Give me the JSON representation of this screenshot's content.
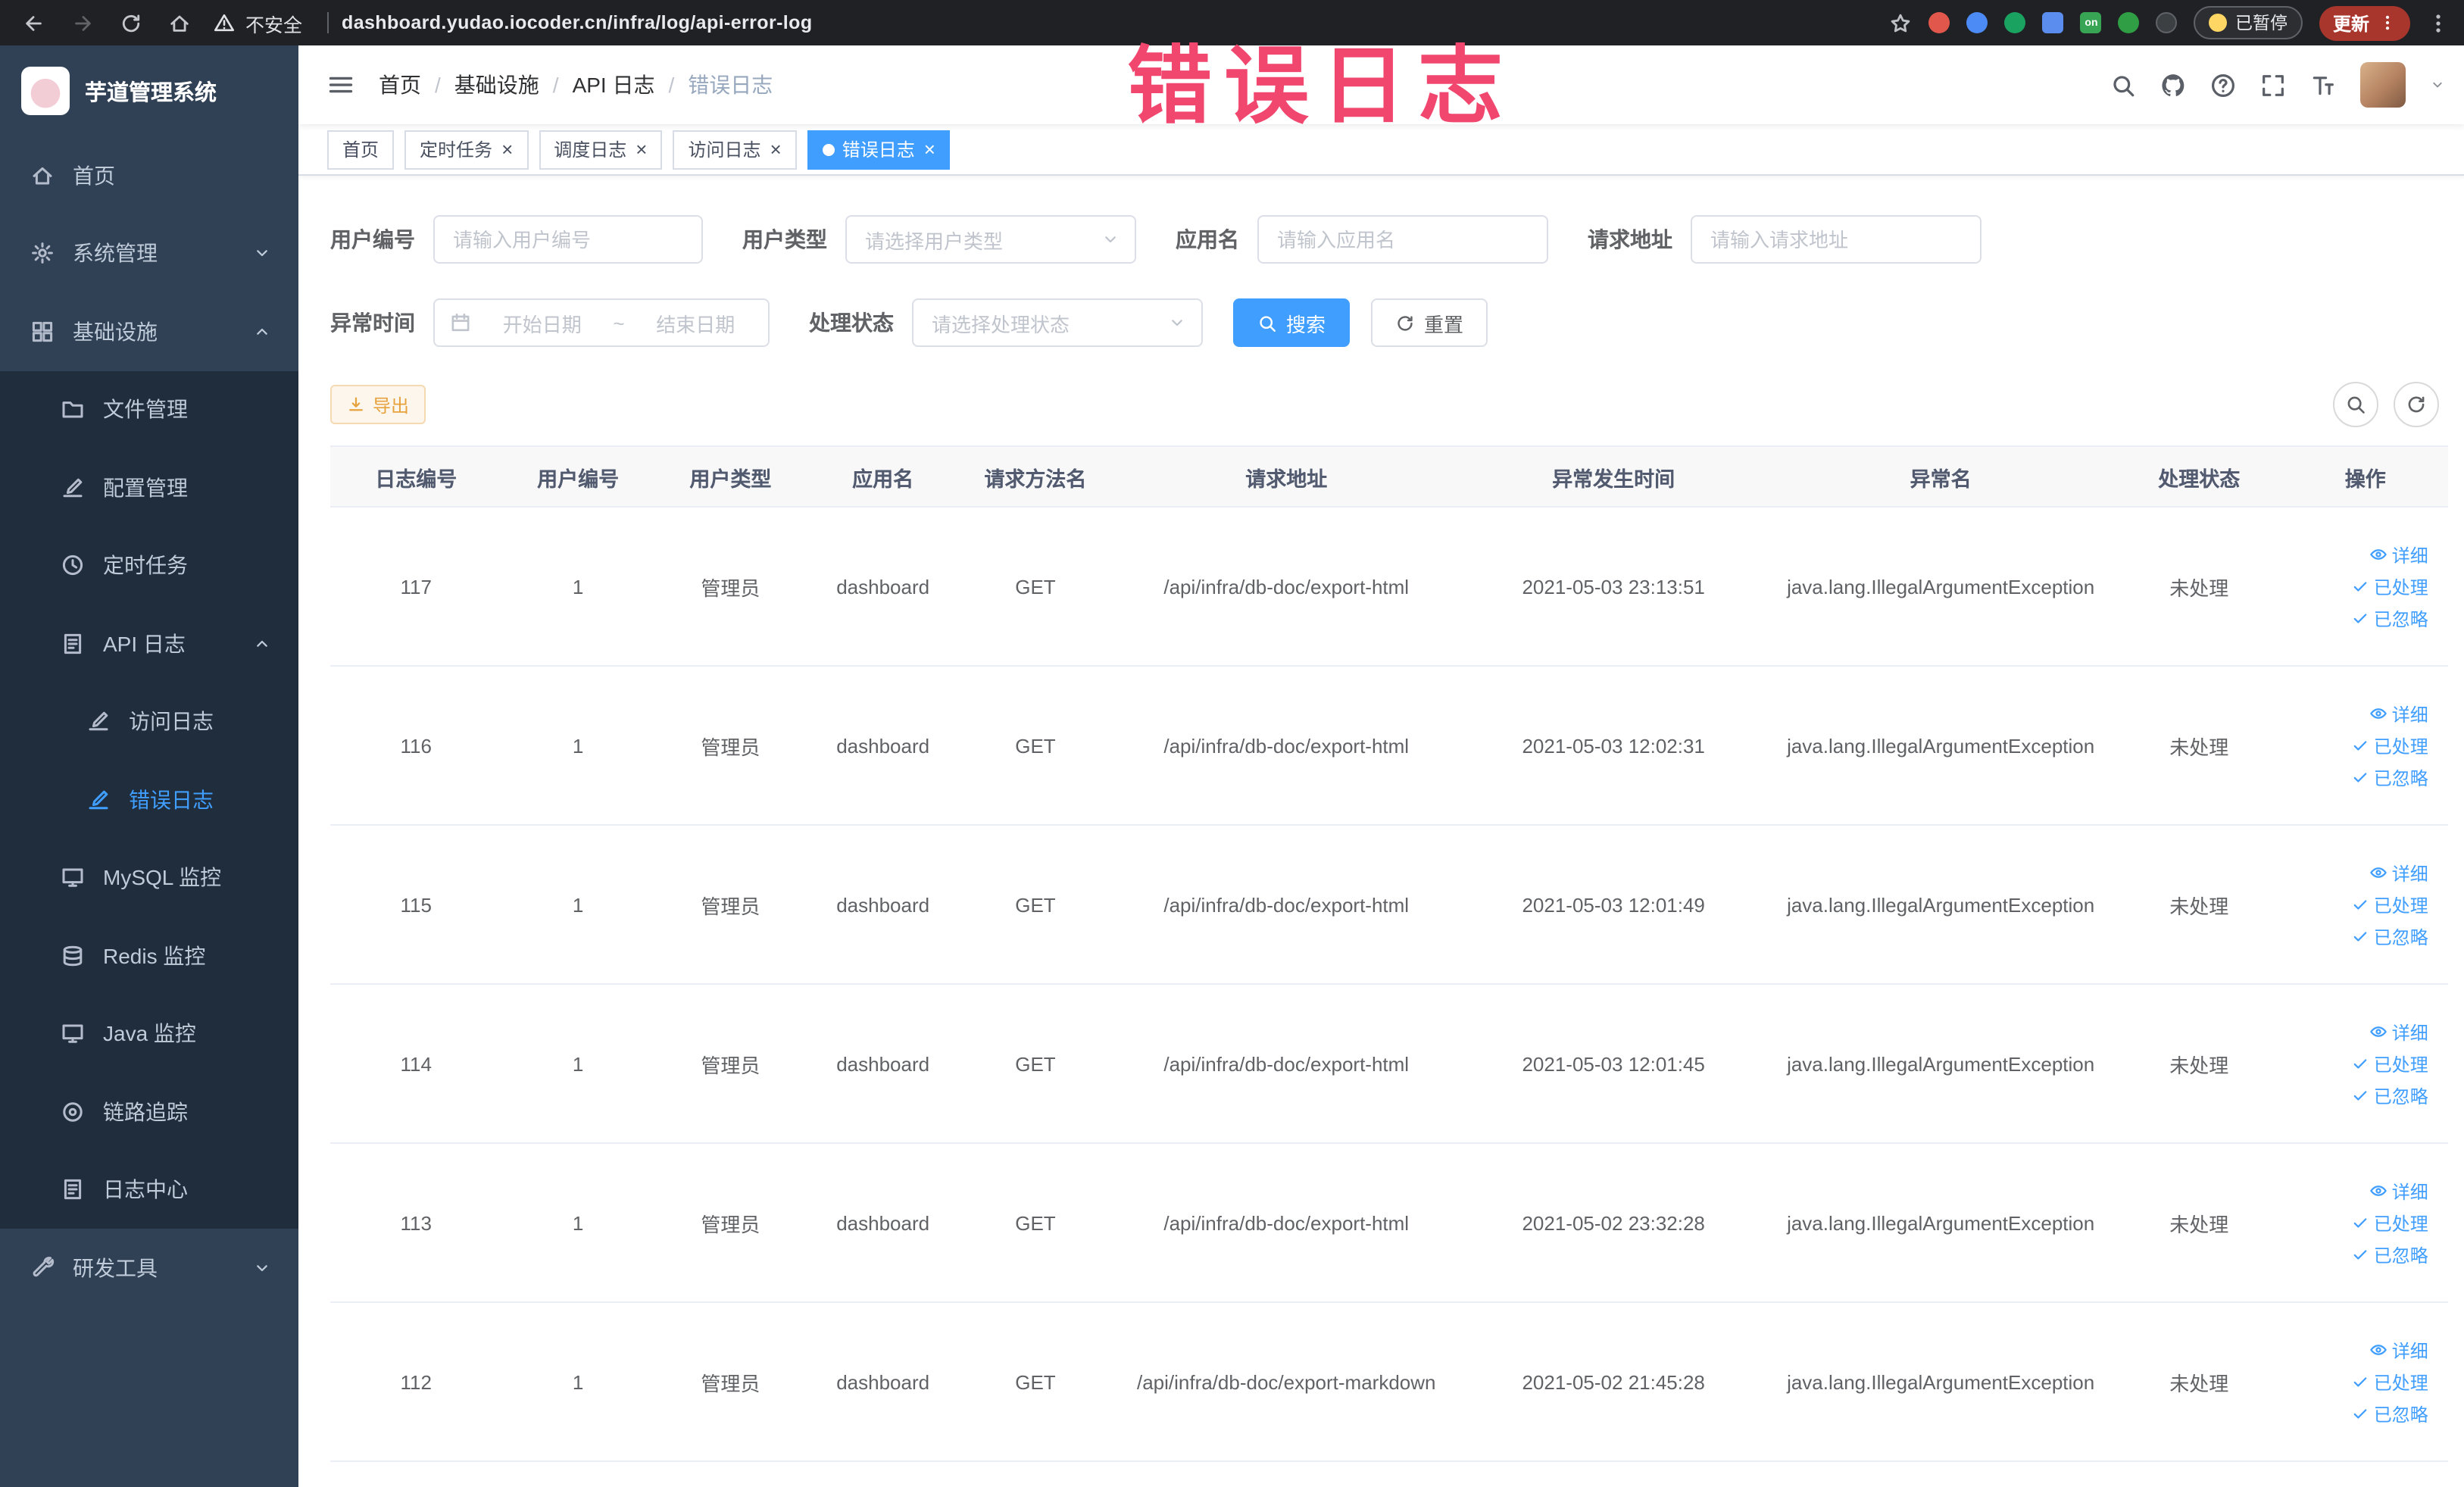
{
  "browser": {
    "security_label": "不安全",
    "url": "dashboard.yudao.iocoder.cn/infra/log/api-error-log",
    "ext_on_label": "on",
    "paused_label": "已暂停",
    "update_label": "更新"
  },
  "watermark": "错误日志",
  "sidebar": {
    "title": "芋道管理系统",
    "items": [
      {
        "label": "首页",
        "icon": "home",
        "level": 0
      },
      {
        "label": "系统管理",
        "icon": "gear",
        "level": 0,
        "chevron": "down"
      },
      {
        "label": "基础设施",
        "icon": "grid",
        "level": 0,
        "chevron": "up"
      },
      {
        "label": "文件管理",
        "icon": "folder",
        "level": 1
      },
      {
        "label": "配置管理",
        "icon": "edit",
        "level": 1
      },
      {
        "label": "定时任务",
        "icon": "clock",
        "level": 1
      },
      {
        "label": "API 日志",
        "icon": "doc",
        "level": 1,
        "chevron": "up"
      },
      {
        "label": "访问日志",
        "icon": "edit",
        "level": 2
      },
      {
        "label": "错误日志",
        "icon": "edit",
        "level": 2,
        "active": true
      },
      {
        "label": "MySQL 监控",
        "icon": "monitor",
        "level": 1
      },
      {
        "label": "Redis 监控",
        "icon": "db",
        "level": 1
      },
      {
        "label": "Java 监控",
        "icon": "monitor",
        "level": 1
      },
      {
        "label": "链路追踪",
        "icon": "target",
        "level": 1
      },
      {
        "label": "日志中心",
        "icon": "doc",
        "level": 1
      },
      {
        "label": "研发工具",
        "icon": "tools",
        "level": 0,
        "chevron": "down"
      }
    ]
  },
  "header": {
    "breadcrumbs": [
      "首页",
      "基础设施",
      "API 日志",
      "错误日志"
    ]
  },
  "tabs": [
    {
      "label": "首页",
      "closable": false,
      "active": false
    },
    {
      "label": "定时任务",
      "closable": true,
      "active": false
    },
    {
      "label": "调度日志",
      "closable": true,
      "active": false
    },
    {
      "label": "访问日志",
      "closable": true,
      "active": false
    },
    {
      "label": "错误日志",
      "closable": true,
      "active": true
    }
  ],
  "filters": {
    "user_id": {
      "label": "用户编号",
      "placeholder": "请输入用户编号"
    },
    "user_type": {
      "label": "用户类型",
      "placeholder": "请选择用户类型"
    },
    "app_name": {
      "label": "应用名",
      "placeholder": "请输入应用名"
    },
    "request_url": {
      "label": "请求地址",
      "placeholder": "请输入请求地址"
    },
    "exception_time": {
      "label": "异常时间",
      "start_placeholder": "开始日期",
      "separator": "~",
      "end_placeholder": "结束日期"
    },
    "process_status": {
      "label": "处理状态",
      "placeholder": "请选择处理状态"
    },
    "search_button": "搜索",
    "reset_button": "重置"
  },
  "toolbar": {
    "export_label": "导出"
  },
  "table": {
    "columns": [
      "日志编号",
      "用户编号",
      "用户类型",
      "应用名",
      "请求方法名",
      "请求地址",
      "异常发生时间",
      "异常名",
      "处理状态",
      "操作"
    ],
    "action_labels": [
      "详细",
      "已处理",
      "已忽略"
    ],
    "rows": [
      {
        "id": "117",
        "user_id": "1",
        "user_type": "管理员",
        "app": "dashboard",
        "method": "GET",
        "url": "/api/infra/db-doc/export-html",
        "time": "2021-05-03 23:13:51",
        "exception": "java.lang.IllegalArgumentException",
        "status": "未处理"
      },
      {
        "id": "116",
        "user_id": "1",
        "user_type": "管理员",
        "app": "dashboard",
        "method": "GET",
        "url": "/api/infra/db-doc/export-html",
        "time": "2021-05-03 12:02:31",
        "exception": "java.lang.IllegalArgumentException",
        "status": "未处理"
      },
      {
        "id": "115",
        "user_id": "1",
        "user_type": "管理员",
        "app": "dashboard",
        "method": "GET",
        "url": "/api/infra/db-doc/export-html",
        "time": "2021-05-03 12:01:49",
        "exception": "java.lang.IllegalArgumentException",
        "status": "未处理"
      },
      {
        "id": "114",
        "user_id": "1",
        "user_type": "管理员",
        "app": "dashboard",
        "method": "GET",
        "url": "/api/infra/db-doc/export-html",
        "time": "2021-05-03 12:01:45",
        "exception": "java.lang.IllegalArgumentException",
        "status": "未处理"
      },
      {
        "id": "113",
        "user_id": "1",
        "user_type": "管理员",
        "app": "dashboard",
        "method": "GET",
        "url": "/api/infra/db-doc/export-html",
        "time": "2021-05-02 23:32:28",
        "exception": "java.lang.IllegalArgumentException",
        "status": "未处理"
      },
      {
        "id": "112",
        "user_id": "1",
        "user_type": "管理员",
        "app": "dashboard",
        "method": "GET",
        "url": "/api/infra/db-doc/export-markdown",
        "time": "2021-05-02 21:45:28",
        "exception": "java.lang.IllegalArgumentException",
        "status": "未处理"
      }
    ]
  }
}
